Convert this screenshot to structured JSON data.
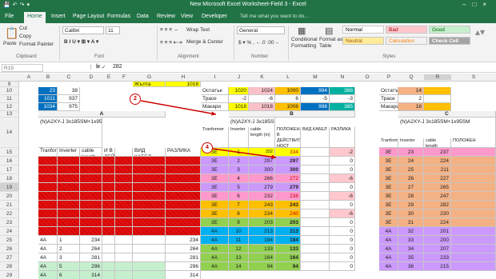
{
  "window": {
    "title": "New Microsoft Excel Worksheet-Field 3 - Excel"
  },
  "tabs": [
    "File",
    "Home",
    "Insert",
    "Page Layout",
    "Formulas",
    "Data",
    "Review",
    "View",
    "Developer"
  ],
  "tell_me": "Tell me what you want to do...",
  "ribbon": {
    "paste": "Paste",
    "cut": "Cut",
    "copy": "Copy",
    "format_painter": "Format Painter",
    "clipboard": "Clipboard",
    "font_name": "Calibri",
    "font_size": "11",
    "font": "Font",
    "wrap_text": "Wrap Text",
    "merge_center": "Merge & Center",
    "alignment": "Alignment",
    "number_format": "General",
    "number": "Number",
    "conditional_formatting": "Conditional Formatting",
    "format_as_table": "Format as Table",
    "styles_label": "Styles",
    "styles": [
      {
        "label": "Normal",
        "bg": "#ffffff",
        "fg": "#000000"
      },
      {
        "label": "Bad",
        "bg": "#ffc7ce",
        "fg": "#9c0006"
      },
      {
        "label": "Good",
        "bg": "#c6efce",
        "fg": "#006100"
      },
      {
        "label": "Neutral",
        "bg": "#ffeb9c",
        "fg": "#9c5700"
      },
      {
        "label": "Calculation",
        "bg": "#f2f2f2",
        "fg": "#fa7d00"
      },
      {
        "label": "Check Cell",
        "bg": "#a5a5a5",
        "fg": "#ffffff"
      }
    ]
  },
  "formula_bar": {
    "cell": "R19",
    "value": "282",
    "fx": "fx"
  },
  "columns": [
    "A",
    "B",
    "C",
    "D",
    "E",
    "F",
    "G",
    "H",
    "I",
    "J",
    "K",
    "L",
    "M",
    "N",
    "O",
    "P",
    "Q",
    "R",
    "S"
  ],
  "rows": [
    "9",
    "10",
    "11",
    "12",
    "13",
    "14",
    "15",
    "16",
    "17",
    "18",
    "19",
    "20",
    "21",
    "22",
    "23",
    "24",
    "25",
    "26",
    "27",
    "28",
    "29"
  ],
  "callouts": [
    "2",
    "4"
  ],
  "left": {
    "top_values": [
      [
        "23",
        "38"
      ],
      [
        "1011",
        "937"
      ],
      [
        "1034",
        "975"
      ]
    ],
    "section": "A",
    "title": "(N)A2XY-J 3x185SM+1x95SM",
    "headers": [
      "Tranformer",
      "Inverter",
      "cable length",
      "И В ДЕЙСТВИТЕ ЛНОСТ",
      "",
      "ВИД КАБЕЛ",
      "РАЗЛИКА"
    ],
    "rows": [
      [
        "4A",
        "1",
        "234",
        "",
        "",
        "",
        "234"
      ],
      [
        "4A",
        "2",
        "264",
        "",
        "",
        "",
        "264"
      ],
      [
        "4A",
        "3",
        "281",
        "",
        "",
        "",
        "281"
      ],
      [
        "4A",
        "5",
        "296",
        "",
        "",
        "",
        "296"
      ],
      [
        "4A",
        "6",
        "314",
        "",
        "",
        "",
        "314"
      ]
    ]
  },
  "center": {
    "zhalta": "Жълта",
    "zhalta_val": "1018",
    "summary": [
      [
        "Остатък",
        "1020",
        "1024",
        "1000",
        "994",
        "388"
      ],
      [
        "Трасе",
        "-2",
        "-6",
        "6",
        "-5",
        "-3"
      ],
      [
        "Макари",
        "1018",
        "1018",
        "1006",
        "998",
        "385"
      ]
    ],
    "section": "B",
    "title": "(N)A2XY-J 3x185SM+1x95SM",
    "headers": [
      "Tranformer",
      "Inverter",
      "cable length (m)",
      "ПОЛОЖЕНИ В ДЕЙСТВИТЕЛ НОСТ",
      "ВИД КАБЕЛ",
      "РАЗЛИКА"
    ],
    "rows": [
      [
        "3E",
        "1",
        "332",
        "334",
        "",
        "-2"
      ],
      [
        "3E",
        "2",
        "297",
        "297",
        "",
        "0"
      ],
      [
        "3E",
        "3",
        "300",
        "300",
        "",
        "0"
      ],
      [
        "3E",
        "4",
        "266",
        "272",
        "",
        "-6"
      ],
      [
        "3E",
        "5",
        "279",
        "279",
        "",
        "0"
      ],
      [
        "3E",
        "6",
        "232",
        "238",
        "",
        "-6"
      ],
      [
        "3E",
        "7",
        "243",
        "243",
        "",
        "0"
      ],
      [
        "3E",
        "8",
        "234",
        "240",
        "",
        "-6"
      ],
      [
        "3E",
        "9",
        "203",
        "203",
        "",
        "0"
      ],
      [
        "4A",
        "10",
        "213",
        "213",
        "",
        "0"
      ],
      [
        "4A",
        "11",
        "184",
        "184",
        "",
        "0"
      ],
      [
        "4A",
        "12",
        "133",
        "133",
        "",
        "0"
      ],
      [
        "4A",
        "13",
        "164",
        "164",
        "",
        "0"
      ],
      [
        "4A",
        "14",
        "94",
        "94",
        "",
        "0"
      ]
    ]
  },
  "right": {
    "summary": [
      [
        "Остатък",
        "14"
      ],
      [
        "Трасе",
        "2"
      ],
      [
        "Макари",
        "16"
      ]
    ],
    "section": "C",
    "title": "(N)A2XY-J 3x185SM+1x95SM",
    "headers": [
      "Tranformer",
      "Inverter",
      "cable length",
      "ПОЛОЖЕН"
    ],
    "rows": [
      [
        "3E",
        "23",
        "237",
        ""
      ],
      [
        "3E",
        "24",
        "224",
        ""
      ],
      [
        "3E",
        "25",
        "211",
        ""
      ],
      [
        "3E",
        "26",
        "227",
        ""
      ],
      [
        "3E",
        "27",
        "265",
        ""
      ],
      [
        "3E",
        "28",
        "247",
        ""
      ],
      [
        "3E",
        "29",
        "282",
        ""
      ],
      [
        "3E",
        "30",
        "230",
        ""
      ],
      [
        "3E",
        "31",
        "224",
        ""
      ],
      [
        "4A",
        "32",
        "201",
        ""
      ],
      [
        "4A",
        "33",
        "200",
        ""
      ],
      [
        "4A",
        "34",
        "207",
        ""
      ],
      [
        "4A",
        "35",
        "233",
        ""
      ],
      [
        "4A",
        "36",
        "215",
        ""
      ]
    ]
  },
  "colors": {
    "excel_green": "#217346",
    "yellow": "#ffff00",
    "orange": "#ffc000",
    "blue": "#0070c0",
    "red": "#ff0000",
    "purple": "#9966cc",
    "pink": "#ff99cc",
    "green": "#92d050",
    "teal": "#00b0a0",
    "salmon": "#f4b183"
  }
}
